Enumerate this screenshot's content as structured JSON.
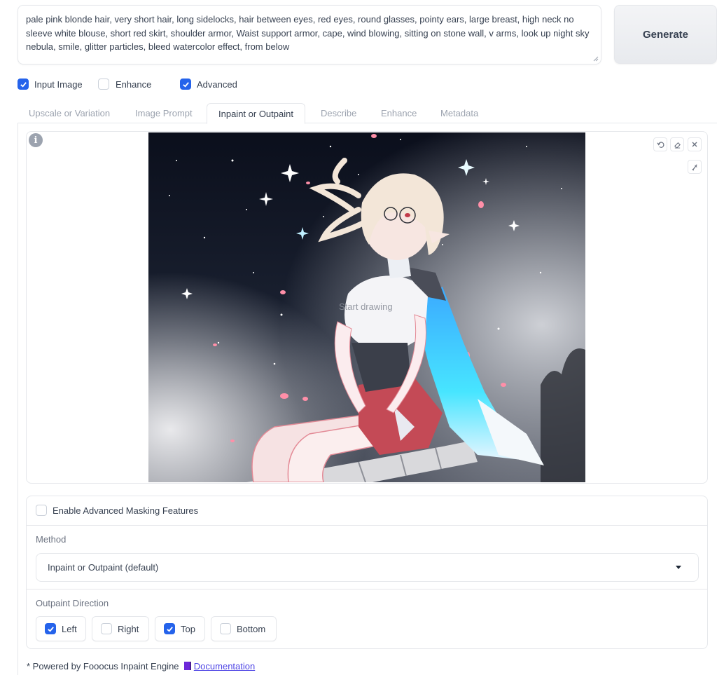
{
  "prompt": {
    "text": "pale pink blonde hair, very short hair, long sidelocks, hair between eyes, red eyes, round glasses, pointy ears, large breast, high neck no sleeve white blouse, short red skirt, shoulder armor, Waist support armor, cape, wind blowing, sitting on stone wall, v arms, look up night sky nebula, smile, glitter particles, bleed watercolor effect, from below"
  },
  "generate_label": "Generate",
  "options": {
    "input_image": {
      "label": "Input Image",
      "checked": true
    },
    "enhance": {
      "label": "Enhance",
      "checked": false
    },
    "advanced": {
      "label": "Advanced",
      "checked": true
    }
  },
  "tabs": [
    {
      "label": "Upscale or Variation",
      "active": false
    },
    {
      "label": "Image Prompt",
      "active": false
    },
    {
      "label": "Inpaint or Outpaint",
      "active": true
    },
    {
      "label": "Describe",
      "active": false
    },
    {
      "label": "Enhance",
      "active": false
    },
    {
      "label": "Metadata",
      "active": false
    }
  ],
  "canvas": {
    "overlay_text": "Start drawing",
    "tools": [
      "undo-icon",
      "eraser-icon",
      "close-icon",
      "brush-icon"
    ]
  },
  "masking": {
    "enable_label": "Enable Advanced Masking Features",
    "enable_checked": false,
    "method_title": "Method",
    "method_value": "Inpaint or Outpaint (default)",
    "direction_title": "Outpaint Direction",
    "directions": [
      {
        "label": "Left",
        "checked": true
      },
      {
        "label": "Right",
        "checked": false
      },
      {
        "label": "Top",
        "checked": true
      },
      {
        "label": "Bottom",
        "checked": false
      }
    ]
  },
  "footer": {
    "text": "* Powered by Fooocus Inpaint Engine",
    "link": "Documentation"
  },
  "colors": {
    "accent": "#2563eb",
    "link": "#4f46e5"
  }
}
